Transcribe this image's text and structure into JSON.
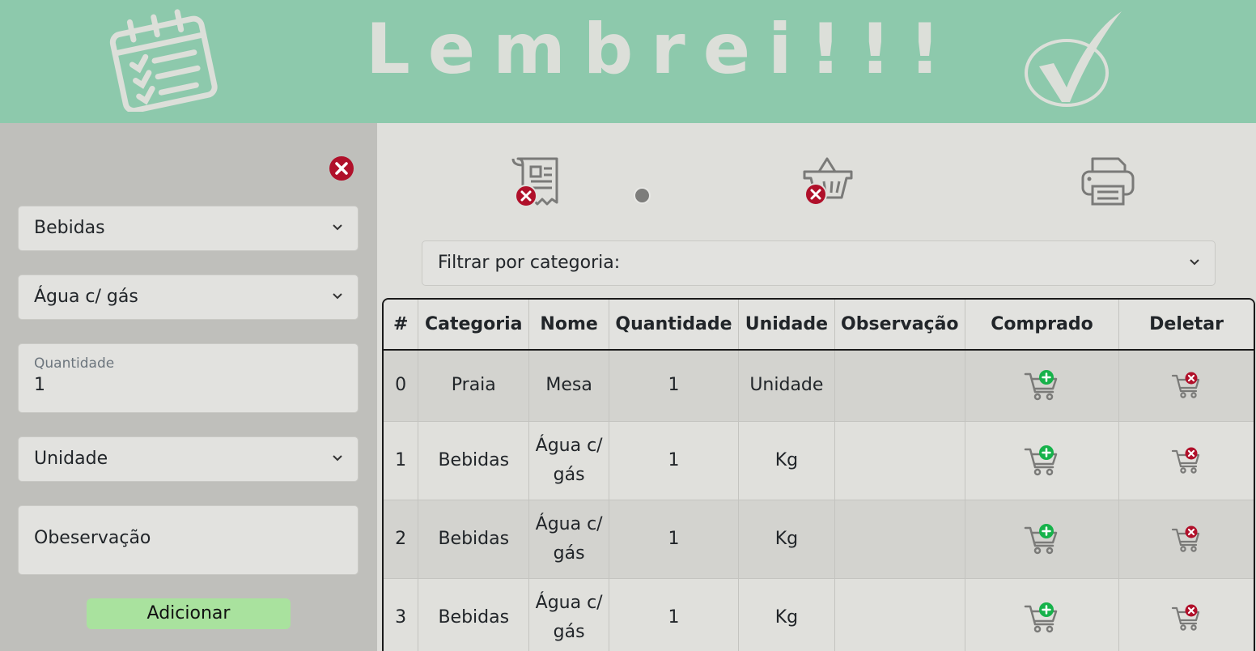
{
  "header": {
    "title": "Lembrei!!!",
    "icons": [
      "calendar-checklist-icon",
      "checkmark-icon"
    ],
    "bg_color": "#8dc9ac"
  },
  "form": {
    "category_value": "Bebidas",
    "item_value": "Água c/ gás",
    "quantity_label": "Quantidade",
    "quantity_value": "1",
    "unit_value": "Unidade",
    "observation_placeholder": "Obeservação",
    "add_label": "Adicionar",
    "add_color": "#a9e29e"
  },
  "toolbar": {
    "icons": [
      "clear-receipt-icon",
      "clear-basket-icon",
      "printer-icon"
    ]
  },
  "filter": {
    "label": "Filtrar por categoria:"
  },
  "table": {
    "headers": [
      "#",
      "Categoria",
      "Nome",
      "Quantidade",
      "Unidade",
      "Observação",
      "Comprado",
      "Deletar"
    ],
    "rows": [
      {
        "idx": "0",
        "category": "Praia",
        "name": "Mesa",
        "qty": "1",
        "unit": "Unidade",
        "obs": ""
      },
      {
        "idx": "1",
        "category": "Bebidas",
        "name": "Água c/ gás",
        "qty": "1",
        "unit": "Kg",
        "obs": ""
      },
      {
        "idx": "2",
        "category": "Bebidas",
        "name": "Água c/ gás",
        "qty": "1",
        "unit": "Kg",
        "obs": ""
      },
      {
        "idx": "3",
        "category": "Bebidas",
        "name": "Água c/ gás",
        "qty": "1",
        "unit": "Kg",
        "obs": ""
      }
    ]
  },
  "colors": {
    "delete_red": "#b0102a",
    "bought_green": "#16b24a"
  }
}
